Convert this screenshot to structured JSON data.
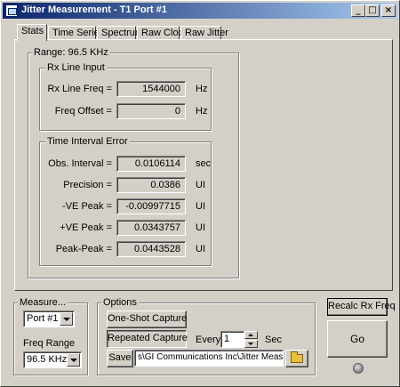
{
  "window": {
    "title": "Jitter Measurement - T1 Port #1",
    "min_glyph": "_",
    "max_glyph": "□",
    "close_glyph": "×"
  },
  "tabs": [
    {
      "label": "Stats",
      "active": true
    },
    {
      "label": "Time Series"
    },
    {
      "label": "Spectrum"
    },
    {
      "label": "Raw Clock"
    },
    {
      "label": "Raw Jitter"
    }
  ],
  "stats": {
    "range_label": "Range: 96.5 KHz",
    "rx_line_input": {
      "title": "Rx Line Input",
      "rows": [
        {
          "label": "Rx Line Freq =",
          "value": "1544000",
          "unit": "Hz"
        },
        {
          "label": "Freq Offset =",
          "value": "0",
          "unit": "Hz"
        }
      ]
    },
    "time_interval_error": {
      "title": "Time Interval Error",
      "rows": [
        {
          "label": "Obs. Interval =",
          "value": "0.0106114",
          "unit": "sec"
        },
        {
          "label": "Precision =",
          "value": "0.0386",
          "unit": "UI"
        },
        {
          "label": "-VE Peak =",
          "value": "-0.00997715",
          "unit": "UI"
        },
        {
          "label": "+VE Peak =",
          "value": "0.0343757",
          "unit": "UI"
        },
        {
          "label": "Peak-Peak =",
          "value": "0.0443528",
          "unit": "UI"
        }
      ]
    }
  },
  "measure": {
    "title": "Measure...",
    "port": "Port #1",
    "freq_range_label": "Freq Range",
    "freq_range": "96.5 KHz"
  },
  "options": {
    "title": "Options",
    "one_shot": "One-Shot Capture",
    "repeated": "Repeated Capture",
    "every_label": "Every",
    "every_value": "1",
    "every_unit": "Sec",
    "save_label": "Save",
    "save_path": "s\\GI Communications Inc\\Jitter Measurement"
  },
  "recalc_label": "Recalc Rx Freq",
  "go_label": "Go"
}
